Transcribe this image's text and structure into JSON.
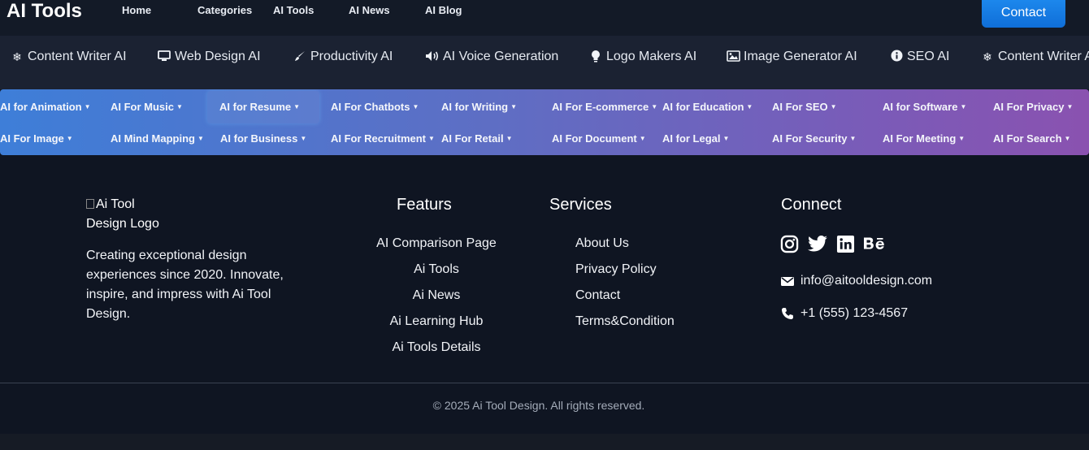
{
  "header": {
    "brand": "AI Tools",
    "nav": [
      "Home",
      "Categories",
      "AI Tools",
      "AI News",
      "AI Blog"
    ],
    "contact_label": "Contact"
  },
  "categories": [
    {
      "icon": "snowflake-icon",
      "label": "Content Writer AI"
    },
    {
      "icon": "desktop-icon",
      "label": "Web Design AI"
    },
    {
      "icon": "paint-brush-icon",
      "label": "Productivity AI"
    },
    {
      "icon": "volume-icon",
      "label": "AI Voice Generation"
    },
    {
      "icon": "lightbulb-icon",
      "label": "Logo Makers AI"
    },
    {
      "icon": "image-icon",
      "label": "Image Generator AI"
    },
    {
      "icon": "info-icon",
      "label": "SEO AI"
    },
    {
      "icon": "snowflake-icon",
      "label": "Content Writer AI"
    }
  ],
  "dropdowns": {
    "row1": [
      "AI for Animation",
      "AI For Music",
      "AI for Resume",
      "AI For Chatbots",
      "AI for Writing",
      "AI For E-commerce",
      "AI for Education",
      "AI For SEO",
      "AI for Software",
      "AI For Privacy"
    ],
    "row2": [
      "AI For Image",
      "AI Mind Mapping",
      "AI for Business",
      "AI For Recruitment",
      "AI For Retail",
      "AI For Document",
      "AI for Legal",
      "AI For Security",
      "AI For Meeting",
      "AI For Search"
    ]
  },
  "footer": {
    "logo_alt": "Ai Tool Design Logo",
    "description": "Creating exceptional design experiences since 2020. Innovate, inspire, and impress with Ai Tool Design.",
    "features": {
      "heading": "Featurs",
      "links": [
        "AI Comparison Page",
        "Ai Tools",
        "Ai News",
        "Ai Learning Hub",
        "Ai Tools Details"
      ]
    },
    "services": {
      "heading": "Services",
      "links": [
        "About Us",
        "Privacy Policy",
        "Contact",
        "Terms&Condition"
      ]
    },
    "connect": {
      "heading": "Connect",
      "social": [
        "instagram-icon",
        "twitter-icon",
        "linkedin-icon",
        "behance-icon"
      ],
      "email": "info@aitooldesign.com",
      "phone": "+1 (555) 123-4567"
    },
    "copyright": "© 2025 Ai Tool Design. All rights reserved."
  },
  "colors": {
    "background": "#0f1522",
    "contact_button": "#1a7fe6",
    "gradient_start": "#3e7ed8",
    "gradient_end": "#8a52b0"
  }
}
